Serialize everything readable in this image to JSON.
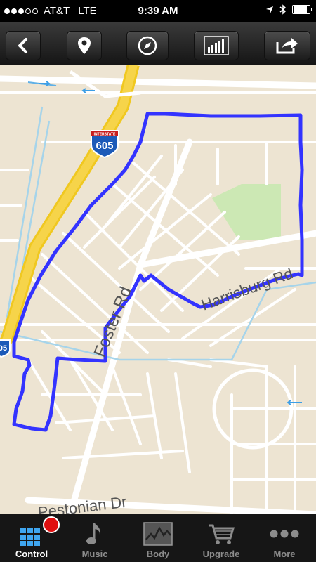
{
  "status_bar": {
    "carrier": "AT&T",
    "network": "LTE",
    "time": "9:39 AM"
  },
  "toolbar": {
    "icons": [
      "back-icon",
      "location-pin-icon",
      "compass-icon",
      "bar-chart-icon",
      "share-icon"
    ]
  },
  "map": {
    "street_labels": [
      "Foster Rd",
      "Harrisburg Rd",
      "Pestonian Dr"
    ],
    "highway_shield": "605",
    "highway_shield_header": "INTERSTATE",
    "highway_shield_partial": "05",
    "route_color": "#3333ff"
  },
  "tabbar": {
    "tabs": [
      {
        "label": "Control",
        "icon": "grid-icon"
      },
      {
        "label": "Music",
        "icon": "music-note-icon"
      },
      {
        "label": "Body",
        "icon": "activity-graph-icon"
      },
      {
        "label": "Upgrade",
        "icon": "cart-icon"
      },
      {
        "label": "More",
        "icon": "more-dots-icon"
      }
    ],
    "active_tab": "Control",
    "record_indicator_color": "#e01010"
  }
}
